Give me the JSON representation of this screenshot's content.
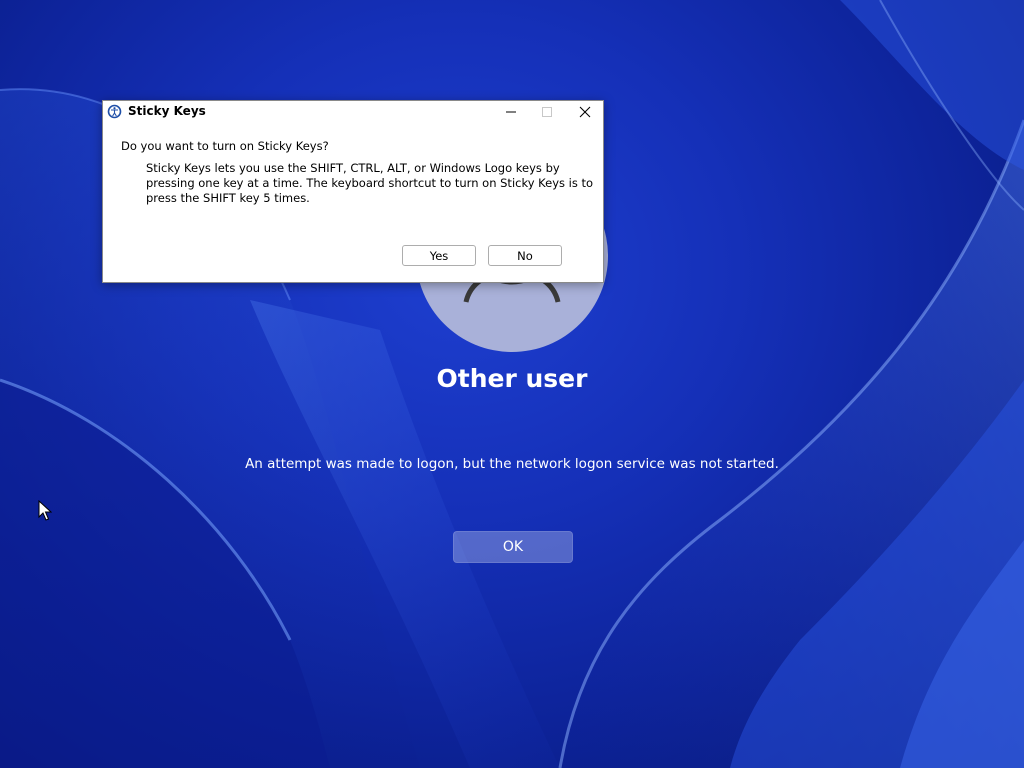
{
  "dialog": {
    "title": "Sticky Keys",
    "question": "Do you want to turn on Sticky Keys?",
    "description": "Sticky Keys lets you use the SHIFT, CTRL, ALT, or Windows Logo keys by pressing one key at a time. The keyboard shortcut to turn on Sticky Keys is to press the SHIFT key 5 times.",
    "yes_label": "Yes",
    "no_label": "No",
    "icons": {
      "app": "ease-of-access-icon",
      "minimize": "minimize-icon",
      "maximize": "maximize-icon",
      "close": "close-icon"
    }
  },
  "login": {
    "user_name": "Other user",
    "message": "An attempt was made to logon, but the network logon service was not started.",
    "ok_label": "OK",
    "avatar_icon": "user-avatar-icon"
  },
  "colors": {
    "wallpaper_blue": "#1530b8",
    "avatar_bg": "#a9b1d9",
    "dialog_bg": "#ffffff"
  }
}
